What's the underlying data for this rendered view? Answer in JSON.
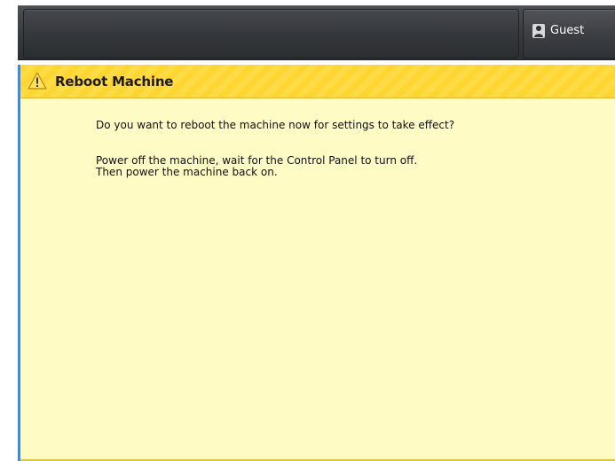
{
  "header": {
    "user": {
      "icon": "user-icon",
      "label": "Guest"
    }
  },
  "dialog": {
    "icon": "warning-icon",
    "title": "Reboot Machine",
    "question": "Do you want to reboot the machine now for settings to take effect?",
    "instructions": [
      "Power off the machine, wait for the Control Panel to turn off.",
      "Then power the machine back on."
    ]
  },
  "colors": {
    "header_dark": "#3a3d41",
    "dialog_bg": "#fffbc4",
    "dialog_header": "#ffd631",
    "accent_left": "#4a86c8"
  }
}
